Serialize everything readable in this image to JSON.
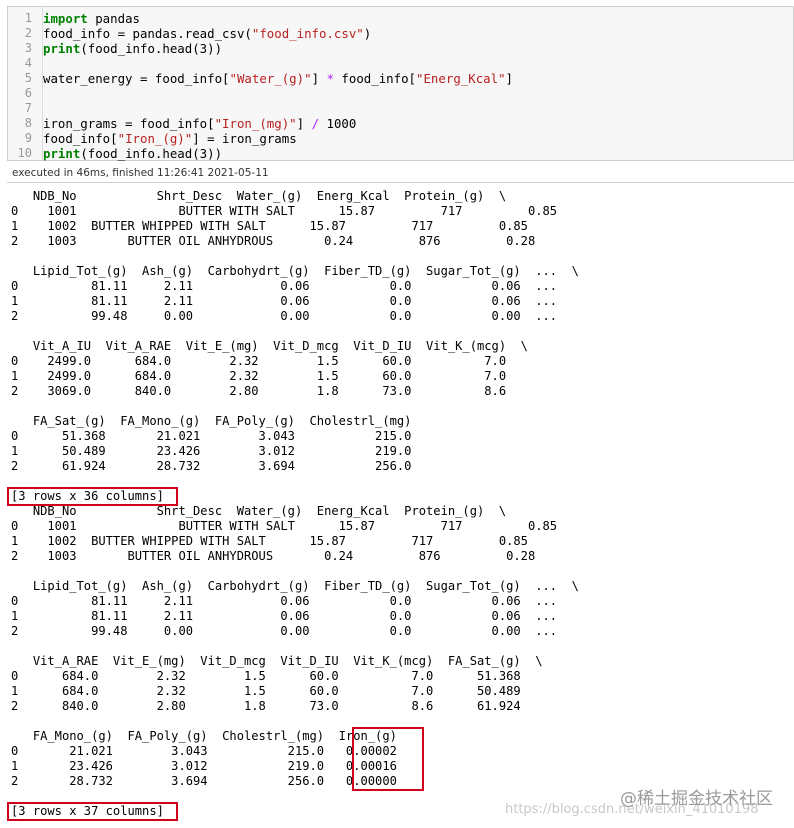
{
  "code_cell": {
    "line_numbers": [
      "1",
      "2",
      "3",
      "4",
      "5",
      "6",
      "7",
      "8",
      "9",
      "10"
    ],
    "lines": [
      {
        "parts": [
          {
            "t": "import",
            "c": "kw"
          },
          {
            "t": " pandas",
            "c": ""
          }
        ]
      },
      {
        "parts": [
          {
            "t": "food_info = pandas.read_csv(",
            "c": ""
          },
          {
            "t": "\"food_info.csv\"",
            "c": "str"
          },
          {
            "t": ")",
            "c": ""
          }
        ]
      },
      {
        "parts": [
          {
            "t": "print",
            "c": "kw"
          },
          {
            "t": "(food_info.head(3))",
            "c": ""
          }
        ]
      },
      {
        "parts": []
      },
      {
        "parts": [
          {
            "t": "water_energy = food_info[",
            "c": ""
          },
          {
            "t": "\"Water_(g)\"",
            "c": "str"
          },
          {
            "t": "] ",
            "c": ""
          },
          {
            "t": "*",
            "c": "op"
          },
          {
            "t": " food_info[",
            "c": ""
          },
          {
            "t": "\"Energ_Kcal\"",
            "c": "str"
          },
          {
            "t": "]",
            "c": ""
          }
        ]
      },
      {
        "parts": []
      },
      {
        "parts": []
      },
      {
        "parts": [
          {
            "t": "iron_grams = food_info[",
            "c": ""
          },
          {
            "t": "\"Iron_(mg)\"",
            "c": "str"
          },
          {
            "t": "] ",
            "c": ""
          },
          {
            "t": "/",
            "c": "op"
          },
          {
            "t": " 1000",
            "c": ""
          }
        ]
      },
      {
        "parts": [
          {
            "t": "food_info[",
            "c": ""
          },
          {
            "t": "\"Iron_(g)\"",
            "c": "str"
          },
          {
            "t": "] = iron_grams",
            "c": ""
          }
        ]
      },
      {
        "parts": [
          {
            "t": "print",
            "c": "kw"
          },
          {
            "t": "(food_info.head(3))",
            "c": ""
          }
        ]
      }
    ]
  },
  "execution_info": "executed in 46ms, finished 11:26:41 2021-05-11",
  "output_lines": [
    "   NDB_No           Shrt_Desc  Water_(g)  Energ_Kcal  Protein_(g)  \\",
    "0    1001              BUTTER WITH SALT      15.87         717         0.85",
    "1    1002  BUTTER WHIPPED WITH SALT      15.87         717         0.85",
    "2    1003       BUTTER OIL ANHYDROUS       0.24         876         0.28",
    "",
    "   Lipid_Tot_(g)  Ash_(g)  Carbohydrt_(g)  Fiber_TD_(g)  Sugar_Tot_(g)  ...  \\",
    "0          81.11     2.11            0.06           0.0           0.06  ...",
    "1          81.11     2.11            0.06           0.0           0.06  ...",
    "2          99.48     0.00            0.00           0.0           0.00  ...",
    "",
    "   Vit_A_IU  Vit_A_RAE  Vit_E_(mg)  Vit_D_mcg  Vit_D_IU  Vit_K_(mcg)  \\",
    "0    2499.0      684.0        2.32        1.5      60.0          7.0",
    "1    2499.0      684.0        2.32        1.5      60.0          7.0",
    "2    3069.0      840.0        2.80        1.8      73.0          8.6",
    "",
    "   FA_Sat_(g)  FA_Mono_(g)  FA_Poly_(g)  Cholestrl_(mg)",
    "0      51.368       21.021        3.043           215.0",
    "1      50.489       23.426        3.012           219.0",
    "2      61.924       28.732        3.694           256.0",
    "",
    "[3 rows x 36 columns]",
    "   NDB_No           Shrt_Desc  Water_(g)  Energ_Kcal  Protein_(g)  \\",
    "0    1001              BUTTER WITH SALT      15.87         717         0.85",
    "1    1002  BUTTER WHIPPED WITH SALT      15.87         717         0.85",
    "2    1003       BUTTER OIL ANHYDROUS       0.24         876         0.28",
    "",
    "   Lipid_Tot_(g)  Ash_(g)  Carbohydrt_(g)  Fiber_TD_(g)  Sugar_Tot_(g)  ...  \\",
    "0          81.11     2.11            0.06           0.0           0.06  ...",
    "1          81.11     2.11            0.06           0.0           0.06  ...",
    "2          99.48     0.00            0.00           0.0           0.00  ...",
    "",
    "   Vit_A_RAE  Vit_E_(mg)  Vit_D_mcg  Vit_D_IU  Vit_K_(mcg)  FA_Sat_(g)  \\",
    "0      684.0        2.32        1.5      60.0          7.0      51.368",
    "1      684.0        2.32        1.5      60.0          7.0      50.489",
    "2      840.0        2.80        1.8      73.0          8.6      61.924",
    "",
    "   FA_Mono_(g)  FA_Poly_(g)  Cholestrl_(mg)  Iron_(g)",
    "0       21.021        3.043           215.0   0.00002",
    "1       23.426        3.012           219.0   0.00016",
    "2       28.732        3.694           256.0   0.00000",
    "",
    "[3 rows x 37 columns]"
  ],
  "watermark": {
    "brand": "@稀土掘金技术社区",
    "url": "https://blog.csdn.net/weixin_41010198"
  },
  "colors": {
    "highlight_box": "#d0021b",
    "keyword": "#008000",
    "string": "#ba2121",
    "operator": "#aa22ff"
  }
}
